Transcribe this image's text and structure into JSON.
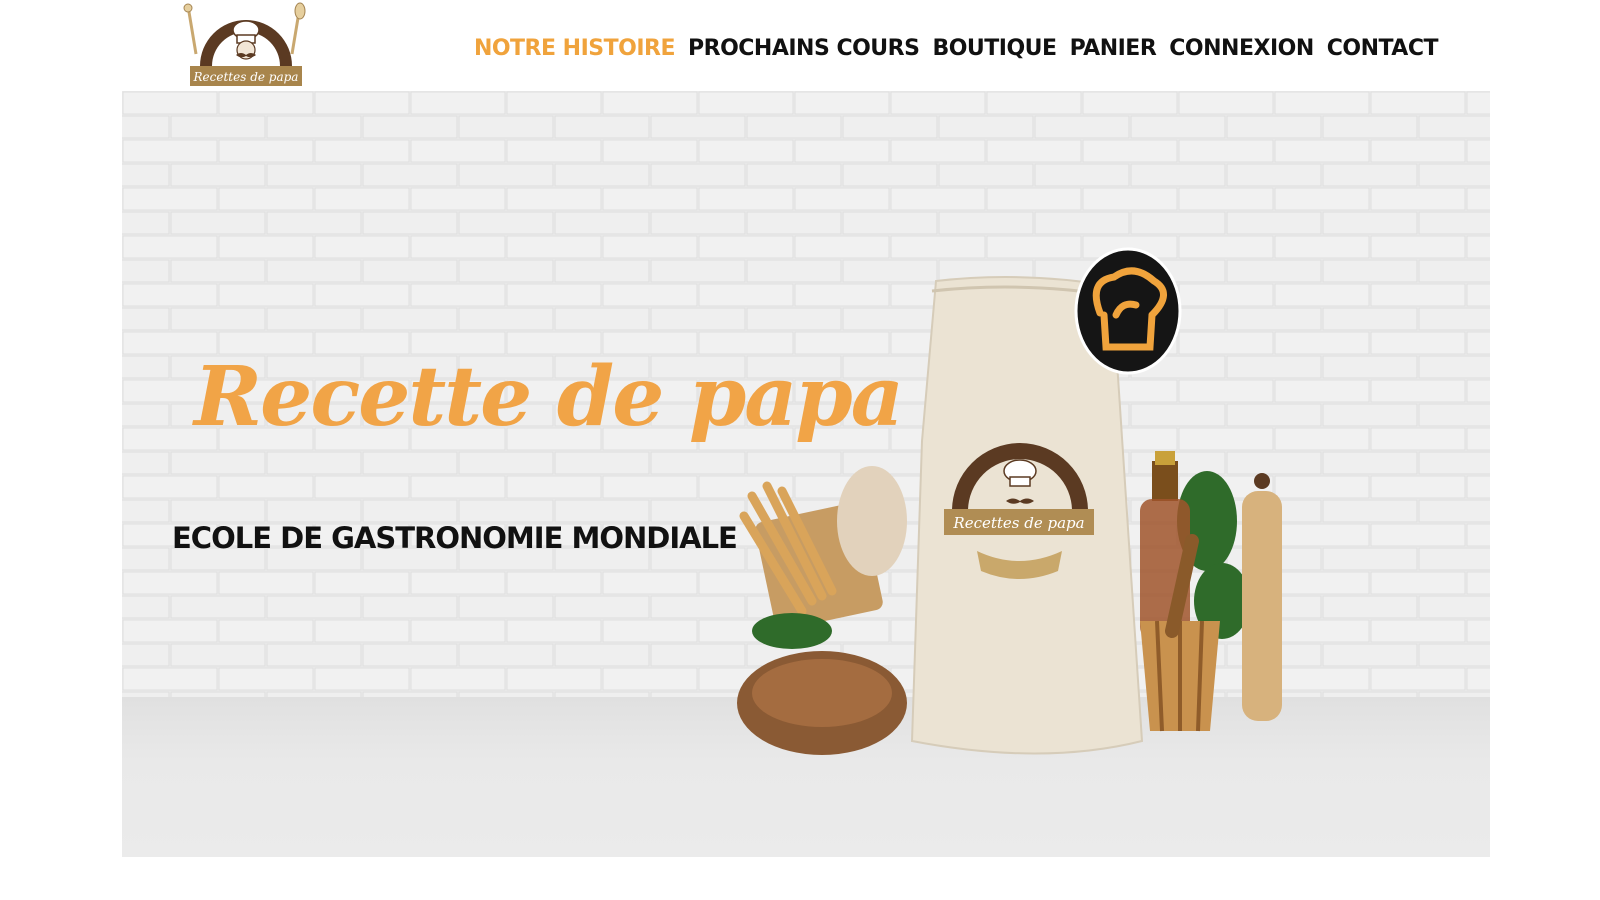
{
  "header": {
    "logo": {
      "caption": "Recettes de papa",
      "icon": "chef-logo-icon"
    },
    "nav": [
      {
        "label": "NOTRE HISTOIRE",
        "active": true
      },
      {
        "label": "PROCHAINS COURS",
        "active": false
      },
      {
        "label": "BOUTIQUE",
        "active": false
      },
      {
        "label": "PANIER",
        "active": false
      },
      {
        "label": "CONNEXION",
        "active": false
      },
      {
        "label": "CONTACT",
        "active": false
      }
    ]
  },
  "hero": {
    "title": "Recette de papa",
    "subtitle": "ECOLE DE GASTRONOMIE MONDIALE",
    "bag_logo_caption": "Recettes de papa",
    "badge_icon": "chef-hat-icon"
  },
  "colors": {
    "accent": "#f0a33c",
    "brown": "#5b3a22",
    "gold": "#b08d54",
    "text": "#111111",
    "wall": "#ececec"
  }
}
